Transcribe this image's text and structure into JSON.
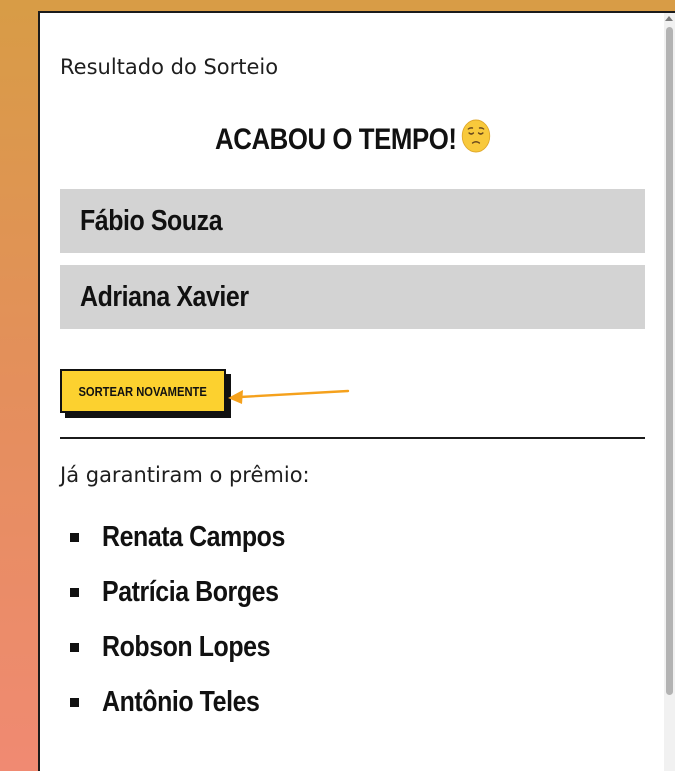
{
  "modal": {
    "title": "Resultado do Sorteio",
    "headline": "ACABOU O TEMPO!",
    "headline_emoji": "pensive-face-icon"
  },
  "winners": [
    {
      "name": "Fábio Souza"
    },
    {
      "name": "Adriana Xavier"
    }
  ],
  "redraw_button": {
    "label": "SORTEAR NOVAMENTE",
    "color": "#fcd12f"
  },
  "annotation": {
    "arrow_color": "#f5a11c"
  },
  "prize_section": {
    "label": "Já garantiram o prêmio:",
    "items": [
      {
        "name": "Renata Campos"
      },
      {
        "name": "Patrícia Borges"
      },
      {
        "name": "Robson Lopes"
      },
      {
        "name": "Antônio Teles"
      }
    ]
  },
  "colors": {
    "winner_bg": "#d3d3d3",
    "text": "#111111"
  }
}
